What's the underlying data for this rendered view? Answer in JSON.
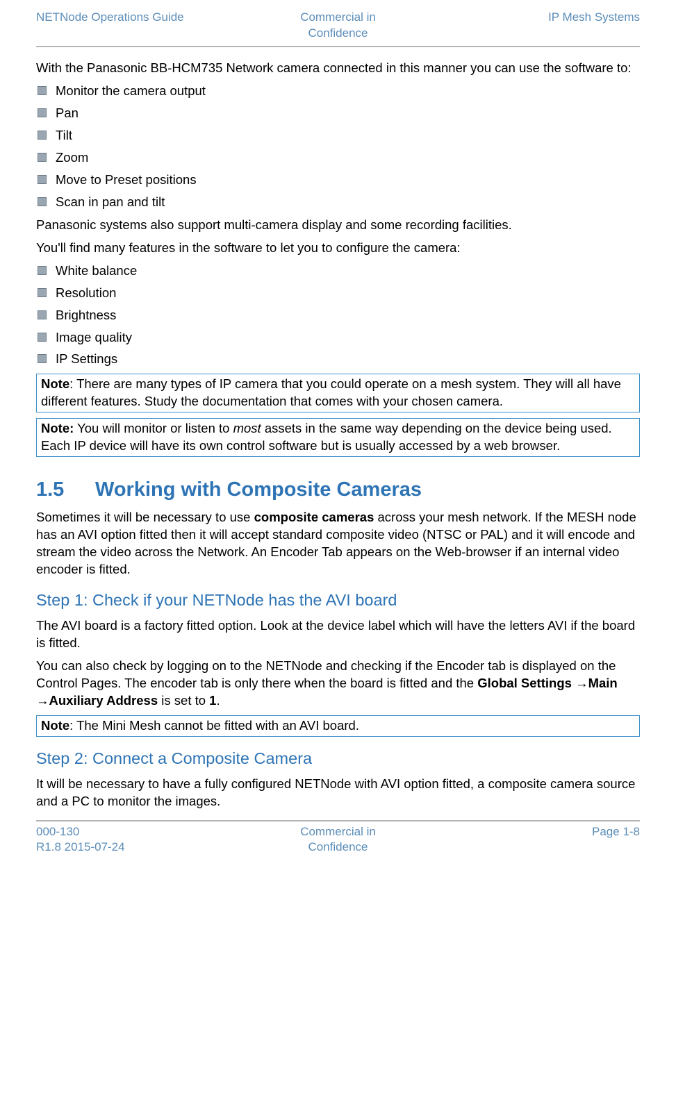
{
  "header": {
    "left": "NETNode Operations Guide",
    "center_l1": "Commercial in",
    "center_l2": "Confidence",
    "right": "IP Mesh Systems"
  },
  "intro": "With the Panasonic BB-HCM735 Network camera connected in this manner you can use the software to:",
  "list1": {
    "i0": "Monitor the camera output",
    "i1": "Pan",
    "i2": "Tilt",
    "i3": "Zoom",
    "i4": "Move to Preset positions",
    "i5": "Scan in pan and tilt"
  },
  "para_multi": "Panasonic systems also support multi-camera display and some recording facilities.",
  "para_features": "You'll find many features in the software to let you to configure the camera:",
  "list2": {
    "i0": "White balance",
    "i1": "Resolution",
    "i2": "Brightness",
    "i3": "Image quality",
    "i4": "IP Settings"
  },
  "note1": {
    "label": "Note",
    "text": ": There are many types of IP camera that you could operate on a mesh system. They will all have different features. Study the documentation that comes with your chosen camera."
  },
  "note2": {
    "label": "Note:",
    "pre": " You will monitor or listen to ",
    "emph": "most",
    "post": " assets in the same way depending on the device being used. Each IP device will have its own control software but is usually accessed by a web browser."
  },
  "section": {
    "num": "1.5",
    "title": "Working with Composite Cameras"
  },
  "section_intro": {
    "pre": "Sometimes it will be necessary to use ",
    "bold": "composite cameras",
    "post": " across your mesh network. If the MESH node has an AVI option fitted then it will accept standard composite video (NTSC or PAL) and it will encode and stream the video across the Network. An Encoder Tab appears on the Web-browser if an internal video encoder is fitted."
  },
  "step1": {
    "title": "Step 1: Check if your NETNode has the AVI board",
    "p1": "The AVI board is a factory fitted option. Look at the device label which will have the letters AVI if the board is fitted.",
    "p2_pre": "You can also check by logging on to the NETNode and checking if the Encoder tab is displayed on the Control Pages. The encoder tab is only there when the board is fitted and the ",
    "p2_b1": "Global Settings ",
    "p2_a1": "→",
    "p2_b2": "Main ",
    "p2_a2": "→",
    "p2_b3": "Auxiliary Address",
    "p2_mid": " is set to ",
    "p2_b4": "1",
    "p2_end": "."
  },
  "note3": {
    "label": "Note",
    "text": ": The Mini Mesh cannot be fitted with an AVI board."
  },
  "step2": {
    "title": "Step 2: Connect a Composite Camera",
    "p1": "It will be necessary to have a fully configured NETNode with AVI option fitted, a composite camera source and a PC to monitor the images."
  },
  "footer": {
    "left_l1": "000-130",
    "left_l2": "R1.8 2015-07-24",
    "center_l1": "Commercial in",
    "center_l2": "Confidence",
    "right": "Page 1-8"
  }
}
